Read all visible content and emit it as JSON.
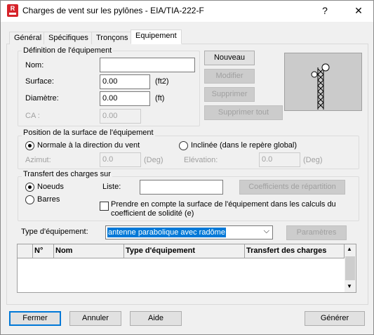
{
  "window": {
    "title": "Charges de vent sur les pylônes - EIA/TIA-222-F",
    "help_glyph": "?",
    "close_glyph": "✕",
    "app_icon": "robot-app-icon"
  },
  "tabs": [
    {
      "label": "Général"
    },
    {
      "label": "Spécifiques"
    },
    {
      "label": "Tronçons"
    },
    {
      "label": "Equipement",
      "active": true
    }
  ],
  "definition": {
    "title": "Définition de l'équipement",
    "nom_label": "Nom:",
    "nom_value": "",
    "surface_label": "Surface:",
    "surface_value": "0.00",
    "surface_unit": "(ft2)",
    "diametre_label": "Diamètre:",
    "diametre_value": "0.00",
    "diametre_unit": "(ft)",
    "ca_label": "CA :",
    "ca_value": "0.00"
  },
  "actions": {
    "nouveau": "Nouveau",
    "modifier": "Modifier",
    "supprimer": "Supprimer",
    "supprimer_tout": "Supprimer tout"
  },
  "position": {
    "title": "Position de la surface de l'équipement",
    "normale": "Normale à la direction du vent",
    "inclinee": "Inclinée (dans le repère global)",
    "azimut_label": "Azimut:",
    "azimut_value": "0.0",
    "azimut_unit": "(Deg)",
    "elevation_label": "Elévation:",
    "elevation_value": "0.0",
    "elevation_unit": "(Deg)"
  },
  "transfert": {
    "title": "Transfert des charges sur",
    "noeuds": "Noeuds",
    "barres": "Barres",
    "liste_label": "Liste:",
    "liste_value": "",
    "coefficients_button": "Coefficients de répartition",
    "prendre_line1": "Prendre en compte la surface de l'équipement dans les calculs du",
    "prendre_line2": "coefficient de solidité (e)"
  },
  "type": {
    "label": "Type d'équipement:",
    "selected": "antenne parabolique avec radôme",
    "parametres_button": "Paramètres"
  },
  "table": {
    "headers": [
      "N°",
      "Nom",
      "Type d'équipement",
      "Transfert des charges"
    ],
    "rows": []
  },
  "footer": {
    "fermer": "Fermer",
    "annuler": "Annuler",
    "aide": "Aide",
    "generer": "Générer"
  },
  "colors": {
    "accent": "#0078d7",
    "app_icon": "#d6232a",
    "preview_bg": "#cbcbcb"
  }
}
